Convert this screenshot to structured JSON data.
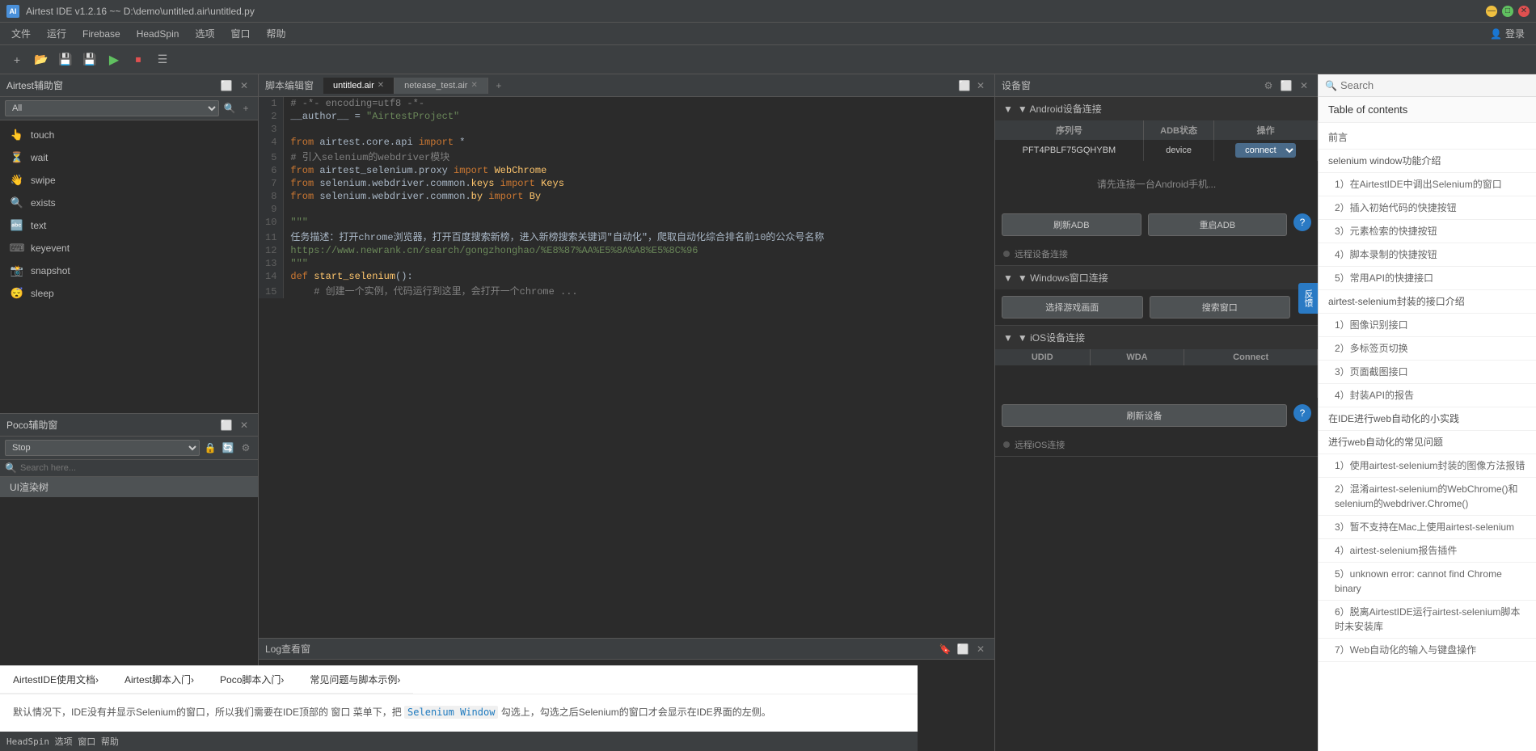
{
  "titlebar": {
    "title": "Airtest IDE v1.2.16 ~~ D:\\demo\\untitled.air\\untitled.py",
    "icon_label": "AI"
  },
  "menubar": {
    "items": [
      "文件",
      "运行",
      "Firebase",
      "HeadSpin",
      "选项",
      "窗口",
      "帮助"
    ],
    "login_label": "登录"
  },
  "toolbar": {
    "new_label": "+",
    "open_label": "📂",
    "save_label": "💾",
    "saveas_label": "💾",
    "run_label": "▶",
    "stop_label": "⏹",
    "device_label": "📱"
  },
  "airtest_panel": {
    "title": "Airtest辅助窗",
    "filter_default": "All",
    "items": [
      {
        "icon": "👆",
        "label": "touch"
      },
      {
        "icon": "⏳",
        "label": "wait"
      },
      {
        "icon": "👋",
        "label": "swipe"
      },
      {
        "icon": "🔍",
        "label": "exists"
      },
      {
        "icon": "🔤",
        "label": "text"
      },
      {
        "icon": "⌨",
        "label": "keyevent"
      },
      {
        "icon": "📸",
        "label": "snapshot"
      },
      {
        "icon": "😴",
        "label": "sleep"
      }
    ]
  },
  "poco_panel": {
    "title": "Poco辅助窗",
    "filter_default": "Stop",
    "search_placeholder": "Search here...",
    "tree_label": "UI渲染树"
  },
  "editor": {
    "title": "脚本编辑窗",
    "tabs": [
      {
        "label": "untitled.air",
        "active": true
      },
      {
        "label": "netease_test.air",
        "active": false
      }
    ],
    "lines": [
      {
        "num": 1,
        "content": "# -*- encoding=utf8 -*-"
      },
      {
        "num": 2,
        "content": "__author__ = \"AirtestProject\""
      },
      {
        "num": 3,
        "content": ""
      },
      {
        "num": 4,
        "content": "from airtest.core.api import *"
      },
      {
        "num": 5,
        "content": "# 引入selenium的webdriver模块"
      },
      {
        "num": 6,
        "content": "from airtest_selenium.proxy import WebChrome"
      },
      {
        "num": 7,
        "content": "from selenium.webdriver.common.keys import Keys"
      },
      {
        "num": 8,
        "content": "from selenium.webdriver.common.by import By"
      },
      {
        "num": 9,
        "content": ""
      },
      {
        "num": 10,
        "content": "\"\"\""
      },
      {
        "num": 11,
        "content": "任务描述：打开chrome浏览器，打开百度搜索新榜，进入新榜搜索关键词\"自动化\"，爬取自动化综合排名前10的公众号名称"
      },
      {
        "num": 12,
        "content": "https://www.newrank.cn/search/gongzhonghao/%E8%87%AA%E5%8A%A8%E5%8C%96"
      },
      {
        "num": 13,
        "content": "\"\"\""
      },
      {
        "num": 14,
        "content": "def start_selenium():"
      },
      {
        "num": 15,
        "content": "    # 创建一个实例，代码运行到这里，会打开一个chrome ..."
      }
    ]
  },
  "log_panel": {
    "title": "Log查看窗"
  },
  "device_panel": {
    "title": "设备窗",
    "android": {
      "section_label": "▼ Android设备连接",
      "columns": [
        "序列号",
        "ADB状态",
        "操作"
      ],
      "row": {
        "serial": "PFT4PBLF75GQHYBM",
        "status": "device",
        "action": "connect"
      },
      "hint": "请先连接一台Android手机...",
      "refresh_btn": "刷新ADB",
      "restart_btn": "重启ADB",
      "remote_label": "远程设备连接"
    },
    "windows": {
      "section_label": "▼ Windows窗口连接",
      "game_btn": "选择游戏画面",
      "search_btn": "搜索窗口"
    },
    "ios": {
      "section_label": "▼ iOS设备连接",
      "columns": [
        "UDID",
        "WDA",
        "Connect"
      ],
      "refresh_btn": "刷新设备",
      "remote_label": "远程iOS连接"
    }
  },
  "docs_panel": {
    "search_placeholder": "Search",
    "toc_title": "able of contents",
    "toc_items": [
      {
        "label": "前言",
        "level": 1
      },
      {
        "label": "selenium window功能介绍",
        "level": 1
      },
      {
        "label": "1）在AirtestIDE中调出Selenium的窗口",
        "level": 2
      },
      {
        "label": "2）插入初始代码的快捷按钮",
        "level": 2
      },
      {
        "label": "3）元素检索的快捷按钮",
        "level": 2
      },
      {
        "label": "4）脚本录制的快捷按钮",
        "level": 2
      },
      {
        "label": "5）常用API的快捷接口",
        "level": 2
      },
      {
        "label": "airtest-selenium封装的接口介绍",
        "level": 1
      },
      {
        "label": "1）图像识别接口",
        "level": 2
      },
      {
        "label": "2）多标签页切换",
        "level": 2
      },
      {
        "label": "3）页面截图接口",
        "level": 2
      },
      {
        "label": "4）封装API的报告",
        "level": 2
      },
      {
        "label": "在IDE进行web自动化的小实践",
        "level": 1
      },
      {
        "label": "进行web自动化的常见问题",
        "level": 1
      },
      {
        "label": "1）使用airtest-selenium封装的图像方法报错",
        "level": 2
      },
      {
        "label": "2）混淆airtest-selenium的WebChrome()和selenium的webdriver.Chrome()",
        "level": 2
      },
      {
        "label": "3）暂不支持在Mac上使用airtest-selenium",
        "level": 2
      },
      {
        "label": "4）airtest-selenium报告插件",
        "level": 2
      },
      {
        "label": "5）unknown error: cannot find Chrome binary",
        "level": 2
      },
      {
        "label": "6）脱离AirtestIDE运行airtest-selenium脚本时未安装库",
        "level": 2
      },
      {
        "label": "7）Web自动化的输入与键盘操作",
        "level": 2
      }
    ],
    "feedback_label": "反馈"
  },
  "bottom_area": {
    "nav_items": [
      {
        "label": "AirtestIDE使用文档"
      },
      {
        "label": "Airtest脚本入门"
      },
      {
        "label": "Poco脚本入门"
      },
      {
        "label": "常见问题与脚本示例"
      }
    ],
    "content": "默认情况下，IDE没有并显示Selenium的窗口，所以我们需要在IDE顶部的 窗口 菜单下，把 Selenium Window 勾选上，勾选之后Selenium的窗口才会显示在IDE界面的左侧。",
    "code_label": "HeadSpin  选项  窗口  帮助"
  }
}
